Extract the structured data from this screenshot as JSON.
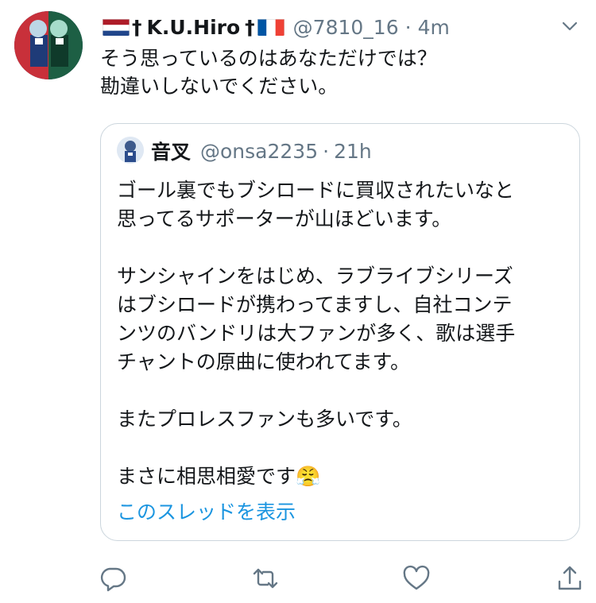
{
  "tweet": {
    "name": "K.U.Hiro",
    "dagger": "†",
    "handle": "@7810_16",
    "separator": "·",
    "time": "4m",
    "lines": [
      "そう思っているのはあなただけでは？",
      "勘違いしないでください。"
    ]
  },
  "quoted": {
    "name": "音叉",
    "handle": "@onsa2235",
    "separator": "·",
    "time": "21h",
    "lines": [
      "ゴール裏でもブシロードに買収されたいなと",
      "思ってるサポーターが山ほどいます。",
      "サンシャインをはじめ、ラブライブシリーズ",
      "はブシロードが携わってますし、自社コンテ",
      "ンツのバンドリは大ファンが多く、歌は選手",
      "チャントの原曲に使われてます。",
      "またプロレスファンも多いです。",
      "まさに相思相愛です"
    ],
    "emoji": "😤",
    "show_thread": "このスレッドを表示"
  },
  "icons": [
    "reply-icon",
    "retweet-icon",
    "like-icon",
    "share-icon",
    "chevron-down-icon",
    "netherlands-flag-icon",
    "france-flag-icon"
  ],
  "colors": {
    "accent": "#1b95e0",
    "muted": "#657786",
    "border": "#ccd6dd"
  }
}
